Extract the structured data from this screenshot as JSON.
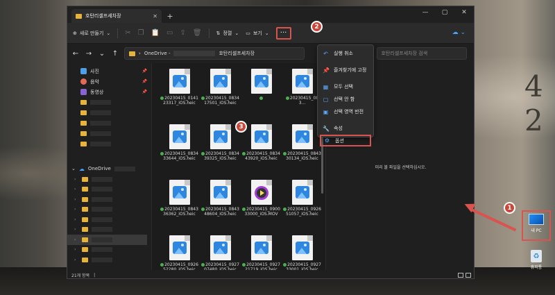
{
  "window": {
    "tab_title": "호탄리셀프세차장",
    "tab_close": "✕",
    "new_tab": "+",
    "controls": [
      "—",
      "▢",
      "✕"
    ]
  },
  "commandbar": {
    "new_label": "새로 만들기",
    "sort_label": "정렬",
    "view_label": "보기",
    "more_label": "···",
    "cloud_label": "☁ ⌄"
  },
  "addressbar": {
    "nav": [
      "←",
      "→",
      "⌄",
      "↑"
    ],
    "path_root": "OneDrive -",
    "path_folder": "호탄리셀프세차장",
    "refresh": "↻",
    "search_placeholder": "호탄리셀프세차장 검색"
  },
  "sidebar": {
    "quick_access": [
      {
        "label": "사진",
        "icon": "photos-icon",
        "pin": "📌"
      },
      {
        "label": "음악",
        "icon": "music-icon",
        "pin": "📌"
      },
      {
        "label": "동영상",
        "icon": "videos-icon",
        "pin": "📌"
      }
    ],
    "onedrive_label": "OneDrive"
  },
  "files": [
    {
      "name": "20230415_014123317_iOS.heic",
      "type": "image"
    },
    {
      "name": "20230415_083417501_iOS.heic",
      "type": "image"
    },
    {
      "name": "",
      "type": "image"
    },
    {
      "name": "20230415_083...",
      "type": "image"
    },
    {
      "name": "20230415_083433644_iOS.heic",
      "type": "image"
    },
    {
      "name": "20230415_083439325_iOS.heic",
      "type": "image"
    },
    {
      "name": "20230415_083443920_iOS.heic",
      "type": "image"
    },
    {
      "name": "20230415_084330134_iOS.heic",
      "type": "image"
    },
    {
      "name": "20230415_084336362_iOS.heic",
      "type": "image"
    },
    {
      "name": "20230415_084348604_iOS.heic",
      "type": "image"
    },
    {
      "name": "20230415_090033000_iOS.MOV",
      "type": "video"
    },
    {
      "name": "20230415_092651057_iOS.heic",
      "type": "image"
    },
    {
      "name": "20230415_092652280_iOS.heic",
      "type": "image"
    },
    {
      "name": "20230415_092707480_iOS.heic",
      "type": "image"
    },
    {
      "name": "20230415_092721719_iOS.heic",
      "type": "image"
    },
    {
      "name": "20230415_092733001_iOS.heic",
      "type": "image"
    }
  ],
  "context_menu": [
    {
      "label": "실행 취소",
      "icon": "undo-icon",
      "glyph": "↶"
    },
    {
      "label": "즐겨찾기에 고정",
      "icon": "pin-icon",
      "glyph": "📌"
    },
    {
      "label": "모두 선택",
      "icon": "select-all-icon",
      "glyph": "▦"
    },
    {
      "label": "선택 안 함",
      "icon": "select-none-icon",
      "glyph": "▢"
    },
    {
      "label": "선택 영역 반전",
      "icon": "invert-selection-icon",
      "glyph": "▣"
    },
    {
      "label": "속성",
      "icon": "properties-icon",
      "glyph": "🔧"
    },
    {
      "label": "옵션",
      "icon": "options-icon",
      "glyph": "⚙"
    }
  ],
  "preview_text": "미리 볼 파일을 선택하십시오.",
  "status": {
    "item_count": "21개 항목",
    "divider": "|"
  },
  "badges": [
    "1",
    "2",
    "3"
  ],
  "desktop": {
    "pc_label": "내 PC",
    "bin_label": "휴지통"
  },
  "colors": {
    "annotation_red": "#d9534f",
    "accent_blue": "#4aa3ff",
    "folder_yellow": "#e8b33b"
  }
}
